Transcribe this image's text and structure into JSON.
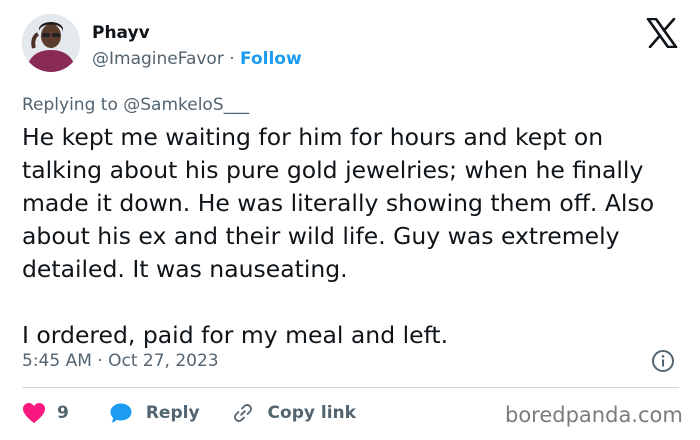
{
  "author": {
    "name": "Phayv",
    "handle": "@ImagineFavor",
    "separator": "·",
    "follow_label": "Follow",
    "avatar_icon": "profile-photo"
  },
  "platform_icon": "x-logo-icon",
  "reply_to": "Replying to @SamkeloS___",
  "post": {
    "paragraphs": [
      "He kept me waiting for him for hours and kept on talking about his pure gold jewelries; when he finally made it down. He was literally showing them off. Also about his ex and their wild life. Guy was extremely detailed. It was nauseating.",
      "I ordered, paid for my meal and left."
    ]
  },
  "meta": {
    "timestamp": "5:45 AM · Oct 27, 2023",
    "info_icon": "info-icon"
  },
  "actions": {
    "like_count": "9",
    "reply_label": "Reply",
    "copy_label": "Copy link",
    "like_icon": "heart-icon",
    "reply_icon": "speech-bubble-icon",
    "copy_icon": "link-icon"
  },
  "colors": {
    "accent": "#1d9bf0",
    "like": "#f91880",
    "text": "#0f1419",
    "secondary": "#536471"
  },
  "watermark": "boredpanda.com"
}
